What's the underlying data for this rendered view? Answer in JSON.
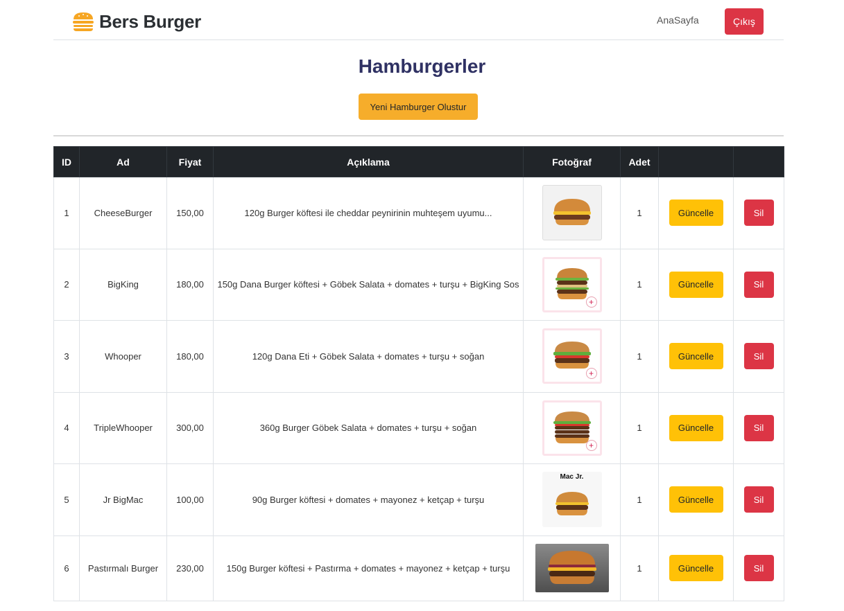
{
  "brand": {
    "name": "Bers Burger",
    "icon": "burger-icon"
  },
  "nav": {
    "home_label": "AnaSayfa",
    "logout_label": "Çıkış"
  },
  "page": {
    "title": "Hamburgerler",
    "create_label": "Yeni Hamburger Olustur"
  },
  "table": {
    "headers": [
      "ID",
      "Ad",
      "Fiyat",
      "Açıklama",
      "Fotoğraf",
      "Adet",
      "",
      ""
    ],
    "update_label": "Güncelle",
    "delete_label": "Sil",
    "rows": [
      {
        "id": "1",
        "name": "CheeseBurger",
        "price": "150,00",
        "description": "120g Burger köftesi ile cheddar peynirinin muhteşem uyumu...",
        "quantity": "1",
        "photo": "cheeseburger-photo"
      },
      {
        "id": "2",
        "name": "BigKing",
        "price": "180,00",
        "description": "150g Dana Burger köftesi + Göbek Salata + domates + turşu + BigKing Sos",
        "quantity": "1",
        "photo": "bigking-photo"
      },
      {
        "id": "3",
        "name": "Whooper",
        "price": "180,00",
        "description": "120g Dana Eti + Göbek Salata + domates + turşu + soğan",
        "quantity": "1",
        "photo": "whooper-photo"
      },
      {
        "id": "4",
        "name": "TripleWhooper",
        "price": "300,00",
        "description": "360g Burger Göbek Salata + domates + turşu + soğan",
        "quantity": "1",
        "photo": "triple-whooper-photo"
      },
      {
        "id": "5",
        "name": "Jr BigMac",
        "price": "100,00",
        "description": "90g Burger köftesi + domates + mayonez + ketçap + turşu",
        "quantity": "1",
        "photo": "jr-bigmac-photo",
        "photo_caption": "Mac Jr."
      },
      {
        "id": "6",
        "name": "Pastırmalı Burger",
        "price": "230,00",
        "description": "150g Burger köftesi + Pastırma + domates + mayonez + ketçap + turşu",
        "quantity": "1",
        "photo": "pastirmali-burger-photo"
      }
    ]
  },
  "colors": {
    "primary_dark": "#212529",
    "danger": "#dc3545",
    "warning": "#ffc107",
    "create": "#f6ad2b",
    "title": "#2f3163"
  }
}
